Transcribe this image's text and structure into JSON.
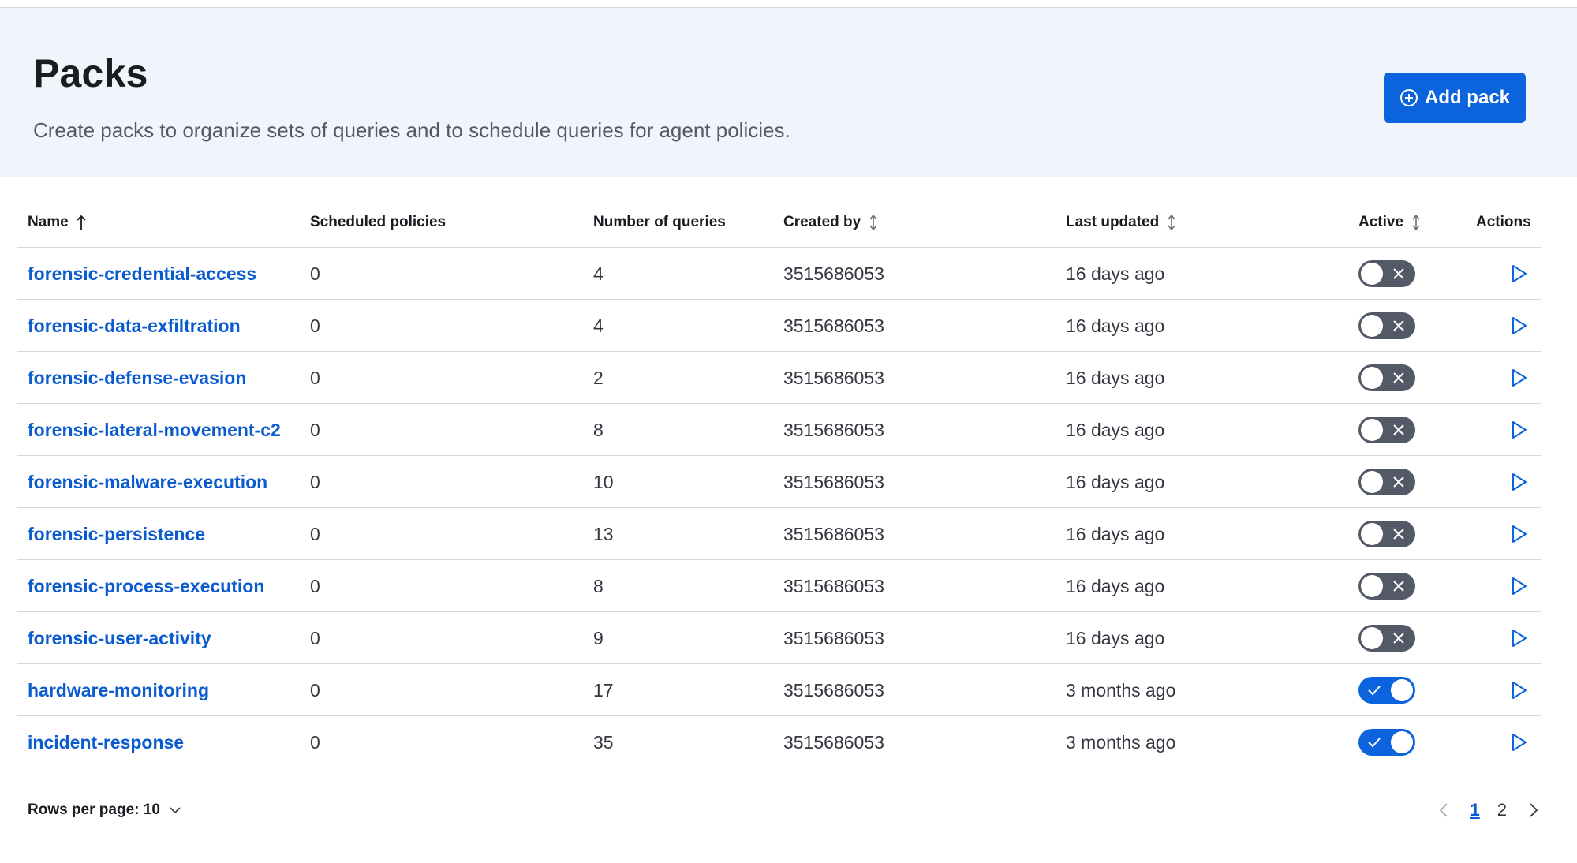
{
  "header": {
    "title": "Packs",
    "description": "Create packs to organize sets of queries and to schedule queries for agent policies.",
    "add_button_label": "Add pack"
  },
  "table": {
    "columns": {
      "name": "Name",
      "scheduled": "Scheduled policies",
      "num_queries": "Number of queries",
      "created_by": "Created by",
      "last_updated": "Last updated",
      "active": "Active",
      "actions": "Actions"
    },
    "rows": [
      {
        "name": "forensic-credential-access",
        "scheduled": "0",
        "num_queries": "4",
        "created_by": "3515686053",
        "last_updated": "16 days ago",
        "active": false
      },
      {
        "name": "forensic-data-exfiltration",
        "scheduled": "0",
        "num_queries": "4",
        "created_by": "3515686053",
        "last_updated": "16 days ago",
        "active": false
      },
      {
        "name": "forensic-defense-evasion",
        "scheduled": "0",
        "num_queries": "2",
        "created_by": "3515686053",
        "last_updated": "16 days ago",
        "active": false
      },
      {
        "name": "forensic-lateral-movement-c2",
        "scheduled": "0",
        "num_queries": "8",
        "created_by": "3515686053",
        "last_updated": "16 days ago",
        "active": false
      },
      {
        "name": "forensic-malware-execution",
        "scheduled": "0",
        "num_queries": "10",
        "created_by": "3515686053",
        "last_updated": "16 days ago",
        "active": false
      },
      {
        "name": "forensic-persistence",
        "scheduled": "0",
        "num_queries": "13",
        "created_by": "3515686053",
        "last_updated": "16 days ago",
        "active": false
      },
      {
        "name": "forensic-process-execution",
        "scheduled": "0",
        "num_queries": "8",
        "created_by": "3515686053",
        "last_updated": "16 days ago",
        "active": false
      },
      {
        "name": "forensic-user-activity",
        "scheduled": "0",
        "num_queries": "9",
        "created_by": "3515686053",
        "last_updated": "16 days ago",
        "active": false
      },
      {
        "name": "hardware-monitoring",
        "scheduled": "0",
        "num_queries": "17",
        "created_by": "3515686053",
        "last_updated": "3 months ago",
        "active": true
      },
      {
        "name": "incident-response",
        "scheduled": "0",
        "num_queries": "35",
        "created_by": "3515686053",
        "last_updated": "3 months ago",
        "active": true
      }
    ]
  },
  "footer": {
    "rows_per_page_label": "Rows per page: 10",
    "pages": [
      "1",
      "2"
    ],
    "current_page": "1"
  },
  "colors": {
    "accent": "#0b64dd",
    "link": "#0b5bd0",
    "toggle_off": "#535966",
    "header_bg": "#f1f4fa"
  },
  "icons": {
    "add": "plus-in-circle-icon",
    "sort_asc": "arrow-up-icon",
    "sortable": "sort-icon",
    "run": "play-icon",
    "toggle_off": "cross-icon",
    "toggle_on": "check-icon",
    "prev": "chevron-left-icon",
    "next": "chevron-right-icon",
    "dropdown": "chevron-down-icon"
  }
}
